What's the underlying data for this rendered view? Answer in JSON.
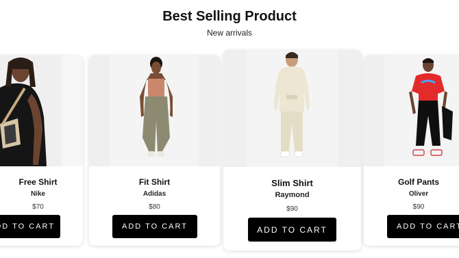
{
  "section": {
    "title": "Best Selling Product",
    "subtitle": "New arrivals"
  },
  "products": [
    {
      "name": "Free Shirt",
      "brand": "Nike",
      "price": "$70",
      "button_label": "ADD TO CART",
      "image_icon": "model-photo"
    },
    {
      "name": "Fit Shirt",
      "brand": "Adidas",
      "price": "$80",
      "button_label": "ADD TO CART",
      "image_icon": "model-photo"
    },
    {
      "name": "Slim Shirt",
      "brand": "Raymond",
      "price": "$90",
      "button_label": "ADD TO CART",
      "image_icon": "model-photo"
    },
    {
      "name": "Golf Pants",
      "brand": "Oliver",
      "price": "$90",
      "button_label": "ADD TO CART",
      "image_icon": "model-photo"
    }
  ],
  "colors": {
    "button_bg": "#000000",
    "button_text": "#ffffff",
    "image_bg": "#efefef"
  }
}
